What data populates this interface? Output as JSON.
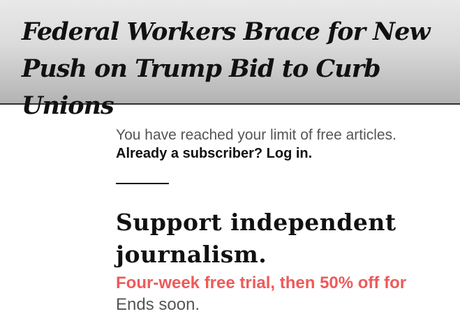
{
  "article": {
    "headline_line1": "Federal Workers Brace for New",
    "headline_line2": "Push on Trump Bid to Curb Unions"
  },
  "paywall": {
    "limit_message": "You have reached your limit of free articles.",
    "subscriber_prompt": "Already a subscriber?",
    "login_label": "Log in.",
    "heading_line1": "Support independent",
    "heading_line2": "journalism.",
    "offer": "Four-week free trial, then 50% off for",
    "ends": "Ends soon."
  },
  "colors": {
    "offer": "#ee5a5a",
    "muted_text": "#555555",
    "text": "#111111"
  }
}
